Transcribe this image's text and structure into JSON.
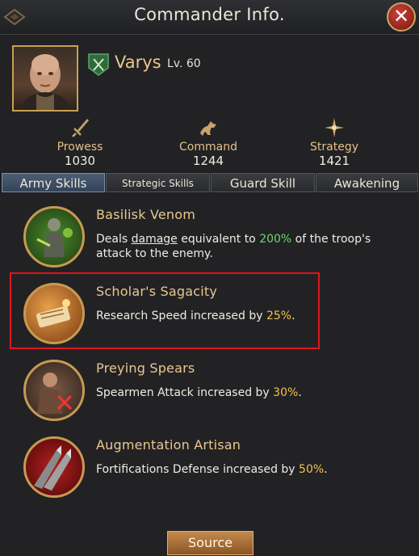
{
  "header": {
    "title": "Commander Info.",
    "close_icon": "close-icon"
  },
  "commander": {
    "name": "Varys",
    "level": "Lv. 60",
    "faction_icon": "crossed-swords-icon"
  },
  "stats": [
    {
      "label": "Prowess",
      "value": "1030",
      "icon": "sword-icon"
    },
    {
      "label": "Command",
      "value": "1244",
      "icon": "horse-icon"
    },
    {
      "label": "Strategy",
      "value": "1421",
      "icon": "star-icon"
    }
  ],
  "tabs": [
    {
      "label": "Army Skills",
      "active": true
    },
    {
      "label": "Strategic Skills",
      "active": false
    },
    {
      "label": "Guard Skill",
      "active": false
    },
    {
      "label": "Awakening",
      "active": false
    }
  ],
  "skills": [
    {
      "title": "Basilisk Venom",
      "desc_parts": [
        "Deals ",
        "damage",
        " equivalent to ",
        "200%",
        " of the troop's attack to the enemy."
      ]
    },
    {
      "title": "Scholar's Sagacity",
      "desc_parts": [
        "Research Speed increased by ",
        "25%",
        "."
      ]
    },
    {
      "title": "Preying Spears",
      "desc_parts": [
        "Spearmen Attack increased by ",
        "30%",
        "."
      ]
    },
    {
      "title": "Augmentation Artisan",
      "desc_parts": [
        "Fortifications Defense increased by ",
        "50%",
        "."
      ]
    }
  ],
  "footer": {
    "source_label": "Source"
  },
  "colors": {
    "accent_gold": "#e9c88d",
    "highlight_green": "#6fd86a",
    "highlight_yellow": "#f2c14e",
    "selection_red": "#e4141a"
  }
}
